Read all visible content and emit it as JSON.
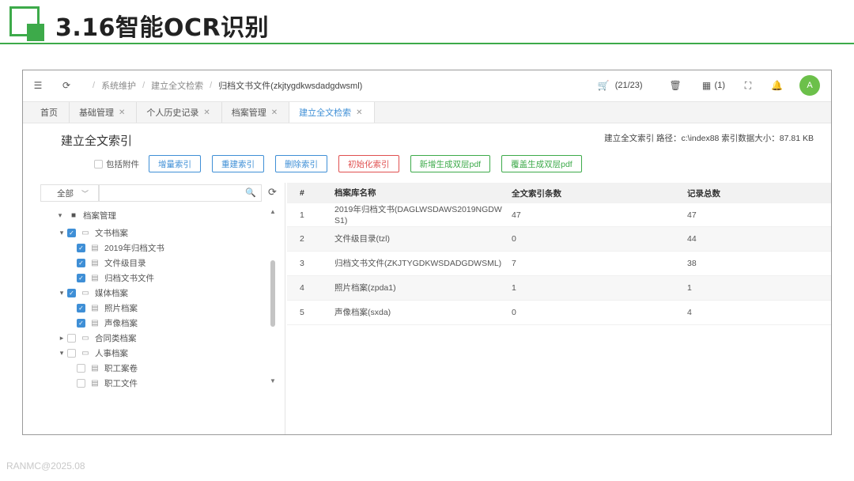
{
  "slide": {
    "title": "3.16智能OCR识别",
    "footer": "RANMC@2025.08"
  },
  "topbar": {
    "breadcrumbs": [
      "系统维护",
      "建立全文检索",
      "归档文书文件(zkjtygdkwsdadgdwsml)"
    ],
    "cart_count": "(21/23)",
    "grid_count": "(1)",
    "avatar_initial": "A"
  },
  "tabs": [
    {
      "label": "首页",
      "closable": false,
      "active": false
    },
    {
      "label": "基础管理",
      "closable": true,
      "active": false
    },
    {
      "label": "个人历史记录",
      "closable": true,
      "active": false
    },
    {
      "label": "档案管理",
      "closable": true,
      "active": false
    },
    {
      "label": "建立全文检索",
      "closable": true,
      "active": true
    }
  ],
  "page": {
    "title": "建立全文索引",
    "index_info": "建立全文索引 路径：c:\\index88 索引数据大小：87.81 KB",
    "include_attachments_label": "包括附件",
    "buttons": {
      "add": "增量索引",
      "rebuild": "重建索引",
      "delete": "删除索引",
      "init": "初始化索引",
      "new_pdf": "新增生成双层pdf",
      "overwrite_pdf": "覆盖生成双层pdf"
    }
  },
  "filter": {
    "select_value": "全部",
    "search_placeholder": ""
  },
  "tree": {
    "root": "档案管理",
    "groups": [
      {
        "label": "文书档案",
        "checked": true,
        "expanded": true,
        "children": [
          {
            "label": "2019年归档文书",
            "checked": true
          },
          {
            "label": "文件级目录",
            "checked": true
          },
          {
            "label": "归档文书文件",
            "checked": true
          }
        ]
      },
      {
        "label": "媒体档案",
        "checked": true,
        "expanded": true,
        "children": [
          {
            "label": "照片档案",
            "checked": true
          },
          {
            "label": "声像档案",
            "checked": true
          }
        ]
      },
      {
        "label": "合同类档案",
        "checked": false,
        "expanded": false,
        "children": []
      },
      {
        "label": "人事档案",
        "checked": false,
        "expanded": true,
        "children": [
          {
            "label": "职工案卷",
            "checked": false
          },
          {
            "label": "职工文件",
            "checked": false
          }
        ]
      }
    ]
  },
  "table": {
    "headers": [
      "#",
      "档案库名称",
      "全文索引条数",
      "记录总数"
    ],
    "rows": [
      {
        "no": "1",
        "name": "2019年归档文书(DAGLWSDAWS2019NGDWS1)",
        "count": "47",
        "total": "47"
      },
      {
        "no": "2",
        "name": "文件级目录(tzl)",
        "count": "0",
        "total": "44"
      },
      {
        "no": "3",
        "name": "归档文书文件(ZKJTYGDKWSDADGDWSML)",
        "count": "7",
        "total": "38"
      },
      {
        "no": "4",
        "name": "照片档案(zpda1)",
        "count": "1",
        "total": "1"
      },
      {
        "no": "5",
        "name": "声像档案(sxda)",
        "count": "0",
        "total": "4"
      }
    ]
  },
  "colors": {
    "brand_green": "#3daa4a",
    "link_blue": "#3f8fd6",
    "danger_red": "#e05050"
  }
}
